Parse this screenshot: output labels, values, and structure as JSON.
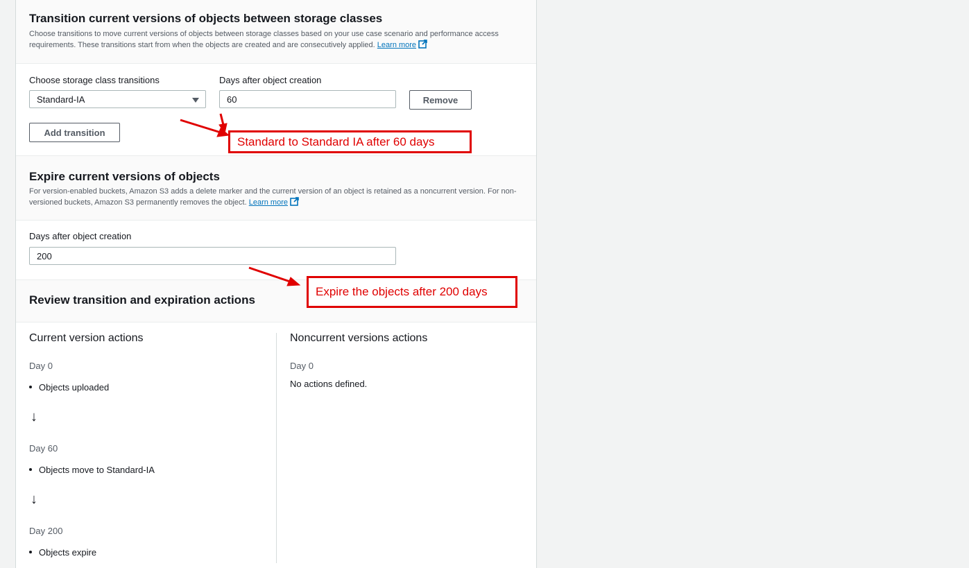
{
  "transition_section": {
    "title": "Transition current versions of objects between storage classes",
    "description": "Choose transitions to move current versions of objects between storage classes based on your use case scenario and performance access requirements. These transitions start from when the objects are created and are consecutively applied.",
    "learn_more": "Learn more",
    "storage_class_label": "Choose storage class transitions",
    "storage_class_value": "Standard-IA",
    "days_label": "Days after object creation",
    "days_value": "60",
    "remove_button": "Remove",
    "add_transition_button": "Add transition"
  },
  "expire_section": {
    "title": "Expire current versions of objects",
    "description": "For version-enabled buckets, Amazon S3 adds a delete marker and the current version of an object is retained as a noncurrent version. For non-versioned buckets, Amazon S3 permanently removes the object.",
    "learn_more": "Learn more",
    "days_label": "Days after object creation",
    "days_value": "200"
  },
  "review_section": {
    "title": "Review transition and expiration actions",
    "current": {
      "heading": "Current version actions",
      "steps": [
        {
          "day": "Day 0",
          "action": "Objects uploaded"
        },
        {
          "day": "Day 60",
          "action": "Objects move to Standard-IA"
        },
        {
          "day": "Day 200",
          "action": "Objects expire"
        }
      ]
    },
    "noncurrent": {
      "heading": "Noncurrent versions actions",
      "day": "Day 0",
      "text": "No actions defined."
    }
  },
  "annotations": {
    "transition_note": "Standard to Standard IA after 60 days",
    "expire_note": "Expire the objects after 200 days",
    "color": "#e00000"
  },
  "icons": {
    "external_link": "external-link-icon",
    "dropdown": "caret-down-icon",
    "step_arrow": "arrow-down-icon"
  }
}
